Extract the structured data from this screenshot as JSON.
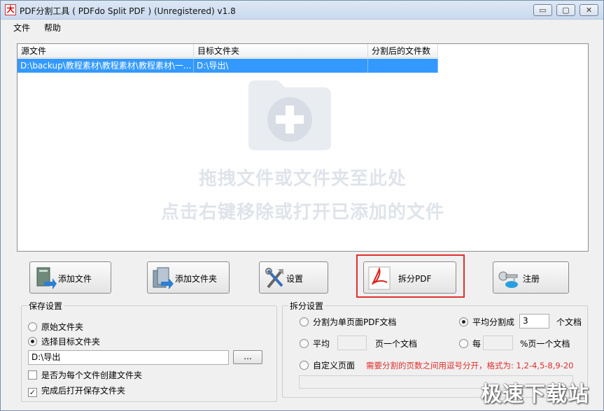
{
  "window": {
    "title": "PDF分割工具 ( PDFdo Split PDF ) (Unregistered) v1.8",
    "app_icon_glyph": "大",
    "minimize_glyph": "▭",
    "maximize_glyph": "▢",
    "close_glyph": "✕"
  },
  "menu": [
    "文件",
    "帮助"
  ],
  "file_list": {
    "columns": [
      "源文件",
      "目标文件夹",
      "分割后的文件数"
    ],
    "rows": [
      {
        "source": "D:\\backup\\教程素材\\教程素材\\教程素材\\一...",
        "target": "D:\\导出\\",
        "count": ""
      }
    ],
    "drop_hint_1": "拖拽文件或文件夹至此处",
    "drop_hint_2": "点击右键移除或打开已添加的文件"
  },
  "buttons": {
    "add_file": "添加文件",
    "add_folder": "添加文件夹",
    "settings": "设置",
    "split_pdf": "拆分PDF",
    "register": "注册"
  },
  "save_settings": {
    "title": "保存设置",
    "option_original": "原始文件夹",
    "option_target": "选择目标文件夹",
    "selected": "选择目标文件夹",
    "target_path": "D:\\导出",
    "browse_label": "...",
    "create_folder_label": "是否为每个文件创建文件夹",
    "create_folder_checked": false,
    "open_after_label": "完成后打开保存文件夹",
    "open_after_checked": true
  },
  "split_settings": {
    "title": "拆分设置",
    "single_page": "分割为单页面PDF文档",
    "average_split": "平均分割成",
    "average_value": "3",
    "average_unit": "个文档",
    "per_prefix": "平均",
    "per_suffix": "页一个文档",
    "per_value": "",
    "percent_prefix": "每",
    "percent_suffix": "%页一个文档",
    "percent_value": "",
    "custom_pages": "自定义页面",
    "custom_note": "需要分割的页数之间用逗号分开，格式为: 1,2-4,5-8,9-20",
    "custom_value": "",
    "selected": "平均分割成"
  },
  "watermark": "极速下载站",
  "colors": {
    "selection": "#3399ff",
    "highlight_border": "#e0302c",
    "note_red": "#e0302c"
  }
}
